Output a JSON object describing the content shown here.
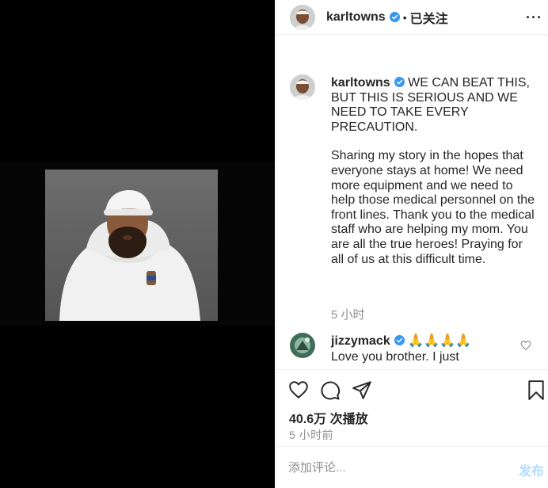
{
  "header": {
    "username": "karltowns",
    "separator": "•",
    "follow_status": "已关注",
    "more_label": "···"
  },
  "caption": {
    "username": "karltowns",
    "first_line": "WE CAN BEAT THIS, BUT THIS IS SERIOUS AND WE NEED TO TAKE EVERY PRECAUTION.",
    "body": "Sharing my story in the hopes that everyone stays at home! We need more equipment and we need to help those medical personnel on the front lines. Thank you to the medical staff who are helping my mom. You are all the true heroes! Praying for all of us at this difficult time.",
    "time": "5 小时"
  },
  "comment": {
    "username": "jizzymack",
    "emojis": "🙏🙏🙏🙏",
    "text": "Love you brother. I just"
  },
  "stats": {
    "views": "40.6万 次播放",
    "posted": "5 小时前"
  },
  "add_comment": {
    "placeholder": "添加评论...",
    "post_label": "发布"
  },
  "colors": {
    "verified_blue": "#3897f0",
    "post_disabled": "#b3dbff",
    "muted": "#8e8e8e"
  },
  "icons": {
    "like": "heart-icon",
    "comment": "comment-icon",
    "share": "send-icon",
    "save": "bookmark-icon",
    "verified": "verified-badge-icon"
  }
}
